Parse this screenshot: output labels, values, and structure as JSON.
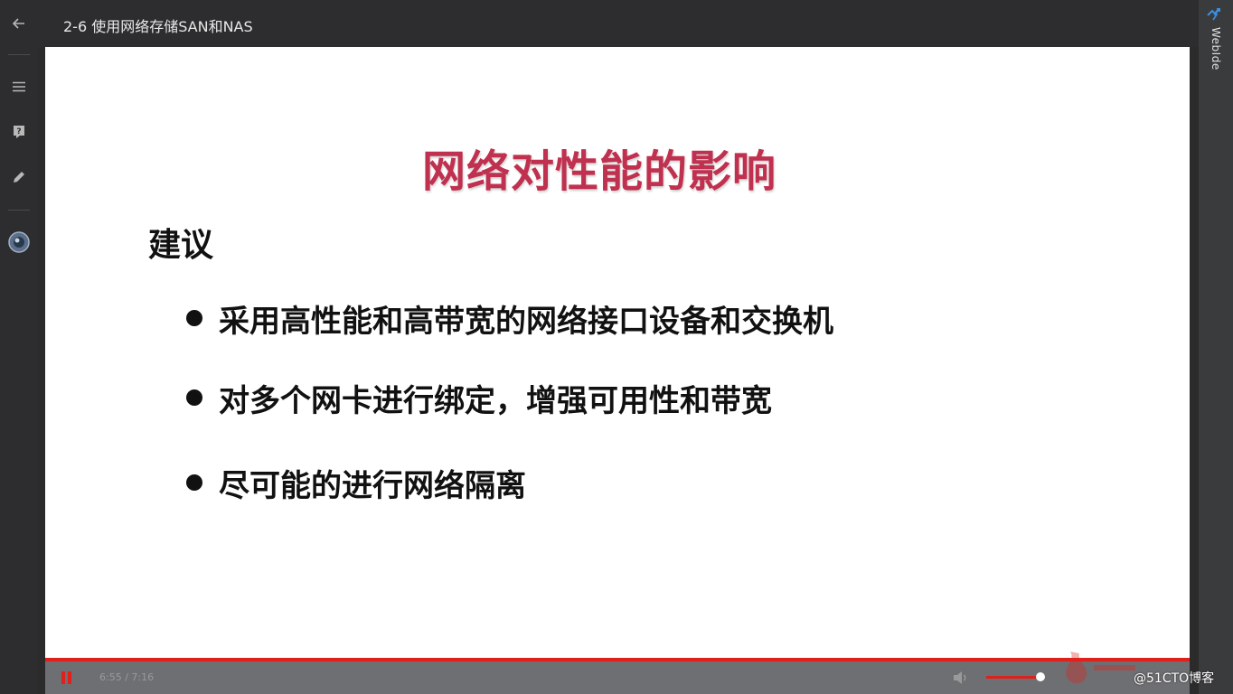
{
  "window": {
    "title": "2-6 使用网络存储SAN和NAS"
  },
  "right_rail": {
    "webide_label": "WebIde"
  },
  "slide": {
    "title": "网络对性能的影响",
    "heading": "建议",
    "bullets": [
      "采用高性能和高带宽的网络接口设备和交换机",
      "对多个网卡进行绑定，增强可用性和带宽",
      "尽可能的进行网络隔离"
    ]
  },
  "player": {
    "time": "6:55 / 7:16",
    "progress_fraction": 0.951,
    "volume_fraction": 1.0
  },
  "watermark": {
    "text": "@51CTO博客"
  },
  "colors": {
    "accent": "#e0201a",
    "slide_title": "#c0304f",
    "chrome": "#2d2d2f",
    "controls": "#6e6f72"
  },
  "icons": {
    "back": "back-arrow-icon",
    "menu": "menu-icon",
    "question": "question-icon",
    "edit": "pencil-icon",
    "avatar": "avatar-icon",
    "webide": "lightning-icon",
    "pause": "pause-icon",
    "volume": "volume-icon"
  }
}
